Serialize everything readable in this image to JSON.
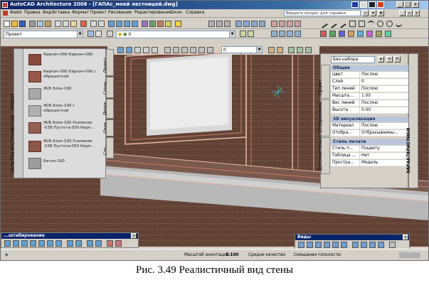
{
  "window": {
    "title": "AutoCAD Architecture 2008 - [ГАПАс_моей лестницей.dwg]",
    "minimize": "_",
    "maximize": "□",
    "close": "x"
  },
  "menu": {
    "items": [
      "Файл",
      "Правка",
      "Вид",
      "Вставка",
      "Формат",
      "Проект",
      "Рисование",
      "Редактирование",
      "Окно",
      "Справка"
    ],
    "help_search_placeholder": "Введите вопрос для справки"
  },
  "toolbar2": {
    "project_combo": "Проект",
    "layer_combo": "0"
  },
  "toolbar3": {
    "layer_combo": "0"
  },
  "tool_palette": {
    "title": "ПАЛИТРЫ ИНСТРУМЕНТОВ - ПРОЕКТ",
    "items": [
      "Кирпич-090 Кирпич-090",
      "Кирпич-090 Кирпич-090 с обрешеткой",
      "Ж/Б блок-190",
      "Ж/Б блок-190 с обрешеткой",
      "Ж/Б блок-190 Усиление -038 Пустота-050 Кирп...",
      "Ж/Б блок-190 Усиление -038 Пустота-050 Кирп...",
      "Бетон-200"
    ],
    "side_tabs": [
      "Проект",
      "Стены",
      "Двери",
      "Окна",
      "Сте..."
    ]
  },
  "properties": {
    "combo": "Без набора",
    "side_tabs": [
      "Проект",
      "Отображение",
      "Дополнительно"
    ],
    "right_title": "ХАРАКТЕРИСТИКИ",
    "sections": [
      {
        "name": "Общие",
        "rows": [
          {
            "key": "Цвет",
            "value": "Послою"
          },
          {
            "key": "Слой",
            "value": "0"
          },
          {
            "key": "Тип линий",
            "value": "Послою"
          },
          {
            "key": "Масшта...",
            "value": "1.00"
          },
          {
            "key": "Вес линий",
            "value": "Послою"
          },
          {
            "key": "Высота",
            "value": "0.00"
          }
        ]
      },
      {
        "name": "3D визуализация",
        "rows": [
          {
            "key": "Материал",
            "value": "Послою"
          },
          {
            "key": "Отобра...",
            "value": "Отбрасываемы..."
          }
        ]
      },
      {
        "name": "Стиль печати",
        "rows": [
          {
            "key": "Стиль п...",
            "value": "Поцвету"
          },
          {
            "key": "Таблица ...",
            "value": "Нет"
          },
          {
            "key": "Простра...",
            "value": "Модель"
          }
        ]
      }
    ]
  },
  "zoom_toolbar": {
    "title": "...штабирование"
  },
  "views_toolbar": {
    "title": "Виды"
  },
  "statusbar": {
    "scale_label": "Масштаб аннотаций:",
    "scale_value": "1:100",
    "quality": "Средне качество",
    "elevation": "Смещение плоскости:"
  },
  "caption": "Рис. 3.49 Реалистичный вид стены"
}
